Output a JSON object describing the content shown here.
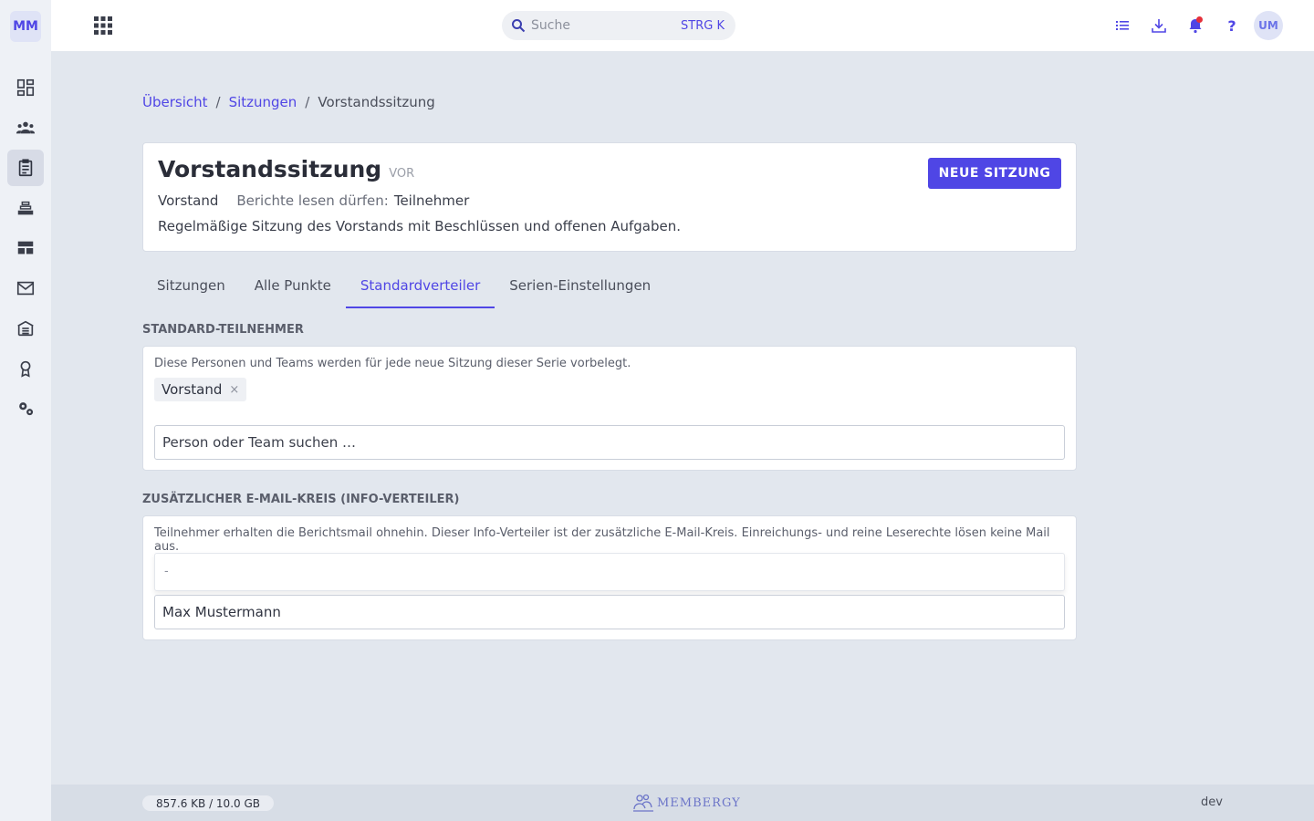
{
  "app": {
    "logo_text": "MM",
    "accent_color": "#4f46e5"
  },
  "sidebar": {
    "items": [
      {
        "icon": "dashboard-icon",
        "active": false
      },
      {
        "icon": "members-icon",
        "active": false
      },
      {
        "icon": "clipboard-icon",
        "active": true
      },
      {
        "icon": "inbox-tray-icon",
        "active": false
      },
      {
        "icon": "table-layout-icon",
        "active": false
      },
      {
        "icon": "mail-icon",
        "active": false
      },
      {
        "icon": "warehouse-icon",
        "active": false
      },
      {
        "icon": "award-icon",
        "active": false
      },
      {
        "icon": "settings-icon",
        "active": false
      }
    ]
  },
  "header": {
    "search_placeholder": "Suche",
    "search_shortcut": "STRG K",
    "help_label": "?",
    "avatar_initials": "UM",
    "notification_badge_color": "#e5303a"
  },
  "breadcrumb": {
    "items": [
      "Übersicht",
      "Sitzungen"
    ],
    "separator": "/",
    "current": "Vorstandssitzung"
  },
  "series": {
    "title": "Vorstandssitzung",
    "abbreviation": "VOR",
    "group": "Vorstand",
    "read_reports_label": "Berichte lesen dürfen:",
    "read_reports_value": "Teilnehmer",
    "description": "Regelmäßige Sitzung des Vorstands mit Beschlüssen und offenen Aufgaben.",
    "new_button_label": "NEUE SITZUNG"
  },
  "tabs": [
    {
      "label": "Sitzungen",
      "active": false
    },
    {
      "label": "Alle Punkte",
      "active": false
    },
    {
      "label": "Standardverteiler",
      "active": true
    },
    {
      "label": "Serien-Einstellungen",
      "active": false
    }
  ],
  "standard_participants": {
    "heading": "STANDARD-TEILNEHMER",
    "note": "Diese Personen und Teams werden für jede neue Sitzung dieser Serie vorbelegt.",
    "chips": [
      {
        "label": "Vorstand",
        "remove": "×"
      }
    ],
    "search_placeholder": "Person oder Team suchen …"
  },
  "info_distribution": {
    "heading": "ZUSÄTZLICHER E-MAIL-KREIS (INFO-VERTEILER)",
    "note": "Teilnehmer erhalten die Berichtsmail ohnehin. Dieser Info-Verteiler ist der zusätzliche E-Mail-Kreis. Einreichungs- und reine Leserechte lösen keine Mail aus.",
    "dropdown_option": "-",
    "input_value": "Max Mustermann"
  },
  "footer": {
    "storage": "857.6 KB / 10.0 GB",
    "brand": "MEMBERGY",
    "environment": "dev"
  }
}
